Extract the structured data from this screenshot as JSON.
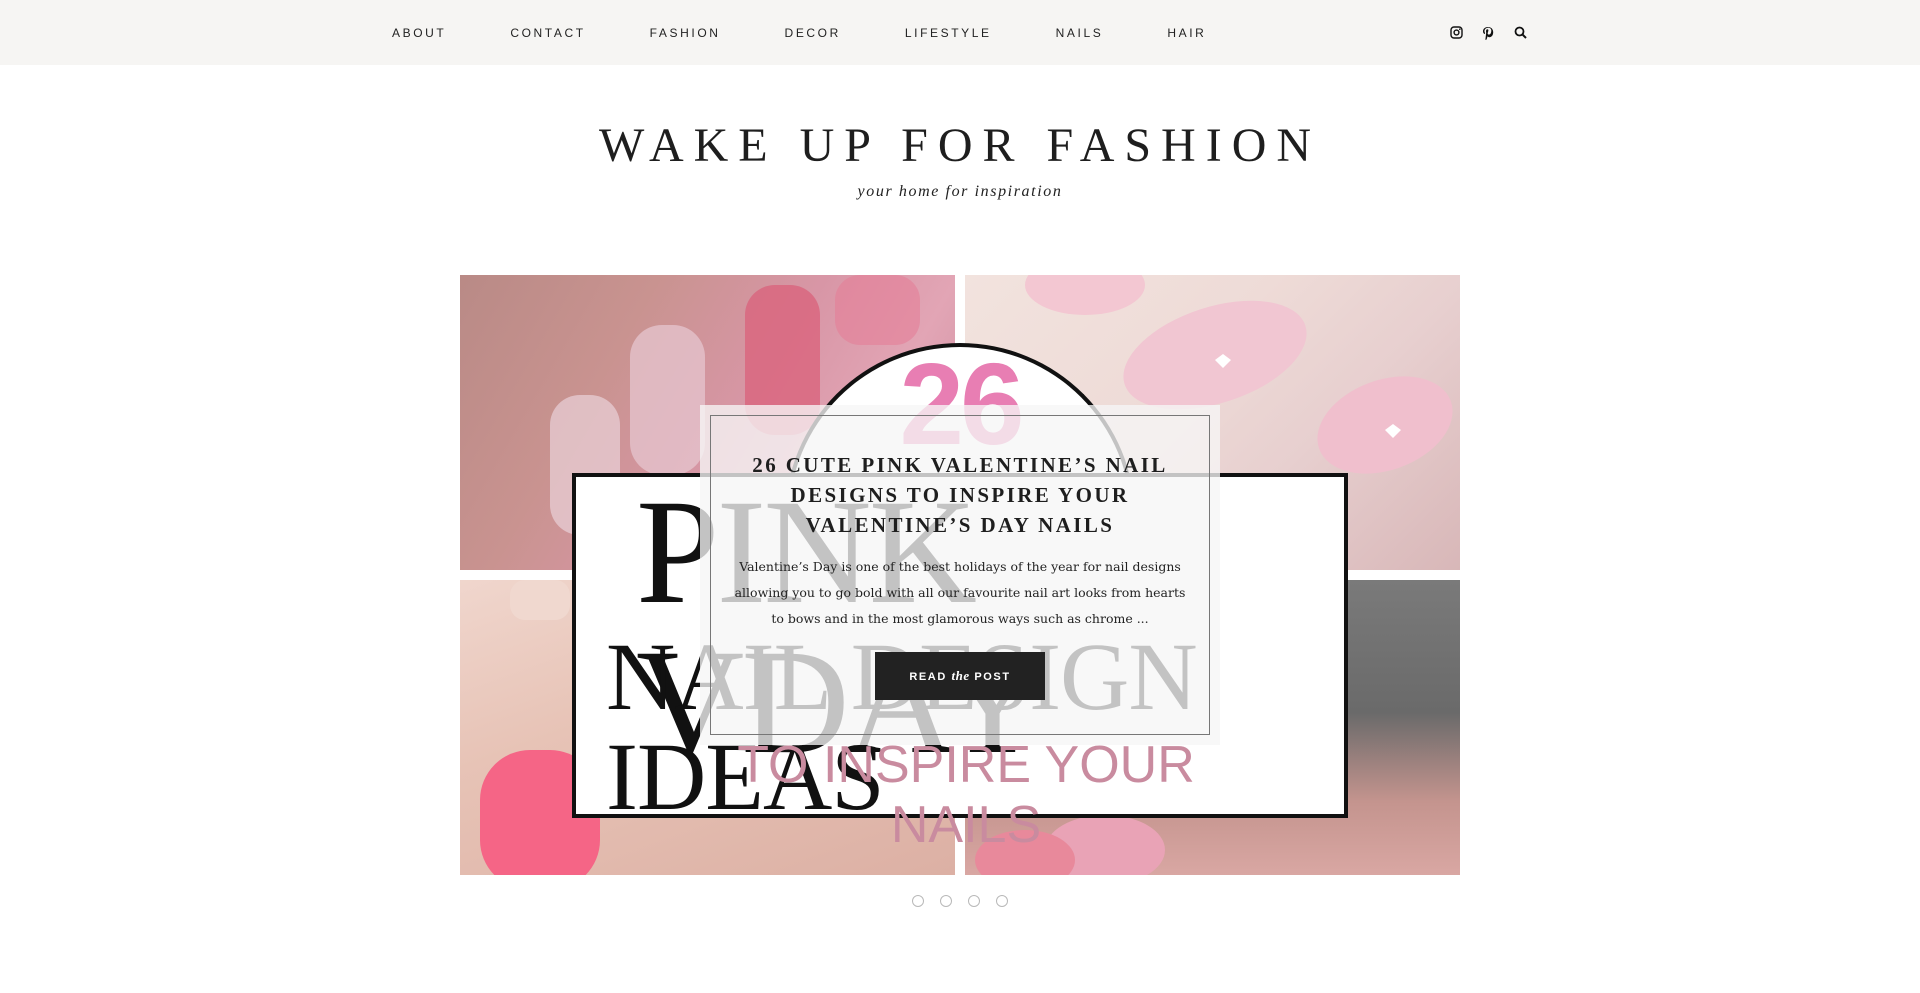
{
  "nav": {
    "items": [
      "ABOUT",
      "CONTACT",
      "FASHION",
      "DECOR",
      "LIFESTYLE",
      "NAILS",
      "HAIR"
    ]
  },
  "social": {
    "icons": [
      "instagram-icon",
      "pinterest-icon",
      "search-icon"
    ]
  },
  "header": {
    "title": "WAKE UP FOR FASHION",
    "tagline": "your home for inspiration"
  },
  "slide": {
    "image_text": {
      "number": "26",
      "line1": "PINK VDAY",
      "line2": "NAIL DESIGN IDEAS",
      "line3": "TO INSPIRE YOUR NAILS"
    },
    "post_title": "26 Cute Pink Valentine’s Nail Designs To Inspire Your Valentine’s Day Nails",
    "excerpt": "Valentine’s Day is one of the best holidays of the year for nail designs allowing you to go bold with all our favourite nail art looks from hearts to bows and in the most glamorous ways such as chrome ...",
    "button": {
      "pre": "READ",
      "mid": "the",
      "post": "POST"
    }
  },
  "colors": {
    "topbar": "#f6f5f3",
    "accent_pink": "#e87eb3",
    "button": "#222222"
  }
}
